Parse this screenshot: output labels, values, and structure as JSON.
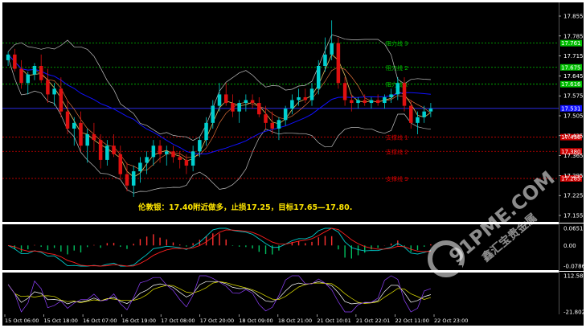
{
  "chart_data": [
    {
      "type": "candlestick",
      "ylim": [
        17.155,
        17.855
      ],
      "price_ticks": [
        "17.855",
        "17.785",
        "17.715",
        "17.645",
        "17.575",
        "17.505",
        "17.435",
        "17.365",
        "17.295",
        "17.225",
        "17.155"
      ],
      "current_price": "17.531",
      "current_price_value": 17.531,
      "x_labels": [
        "15 Oct 06:00",
        "15 Oct 18:00",
        "16 Oct 07:00",
        "16 Oct 19:00",
        "17 Oct 08:00",
        "17 Oct 20:00",
        "18 Oct 09:00",
        "18 Oct 21:00",
        "21 Oct 10:01",
        "21 Oct 22:01",
        "22 Oct 11:00",
        "22 Oct 23:00"
      ],
      "levels": [
        {
          "name": "阻力线 3",
          "value": 17.76,
          "tag": "17.761",
          "kind": "resistance"
        },
        {
          "name": "阻力线 2",
          "value": 17.675,
          "tag": "17.675",
          "kind": "resistance"
        },
        {
          "name": "阻力线 1",
          "value": 17.616,
          "tag": "17.616",
          "kind": "resistance"
        },
        {
          "name": "支撑线 1",
          "value": 17.43,
          "tag": "17.430",
          "kind": "support"
        },
        {
          "name": "支撑线 2",
          "value": 17.38,
          "tag": "17.380",
          "kind": "support"
        },
        {
          "name": "支撑线 3",
          "value": 17.285,
          "tag": "17.285",
          "kind": "support"
        }
      ],
      "candles_ohlc": [
        [
          17.7,
          17.73,
          17.68,
          17.72
        ],
        [
          17.72,
          17.74,
          17.66,
          17.67
        ],
        [
          17.67,
          17.7,
          17.6,
          17.62
        ],
        [
          17.62,
          17.66,
          17.58,
          17.65
        ],
        [
          17.65,
          17.69,
          17.63,
          17.68
        ],
        [
          17.68,
          17.72,
          17.62,
          17.63
        ],
        [
          17.63,
          17.67,
          17.55,
          17.58
        ],
        [
          17.58,
          17.62,
          17.54,
          17.6
        ],
        [
          17.6,
          17.64,
          17.5,
          17.52
        ],
        [
          17.52,
          17.56,
          17.44,
          17.46
        ],
        [
          17.46,
          17.5,
          17.4,
          17.48
        ],
        [
          17.48,
          17.52,
          17.38,
          17.4
        ],
        [
          17.4,
          17.46,
          17.34,
          17.44
        ],
        [
          17.44,
          17.48,
          17.38,
          17.42
        ],
        [
          17.42,
          17.44,
          17.32,
          17.35
        ],
        [
          17.35,
          17.42,
          17.33,
          17.4
        ],
        [
          17.4,
          17.44,
          17.36,
          17.37
        ],
        [
          17.37,
          17.4,
          17.28,
          17.3
        ],
        [
          17.3,
          17.34,
          17.24,
          17.26
        ],
        [
          17.26,
          17.33,
          17.22,
          17.31
        ],
        [
          17.31,
          17.36,
          17.27,
          17.34
        ],
        [
          17.34,
          17.38,
          17.3,
          17.36
        ],
        [
          17.36,
          17.42,
          17.33,
          17.4
        ],
        [
          17.4,
          17.42,
          17.34,
          17.37
        ],
        [
          17.37,
          17.4,
          17.33,
          17.38
        ],
        [
          17.38,
          17.4,
          17.34,
          17.36
        ],
        [
          17.36,
          17.38,
          17.32,
          17.35
        ],
        [
          17.35,
          17.37,
          17.3,
          17.33
        ],
        [
          17.33,
          17.4,
          17.31,
          17.38
        ],
        [
          17.38,
          17.43,
          17.36,
          17.42
        ],
        [
          17.42,
          17.5,
          17.4,
          17.48
        ],
        [
          17.48,
          17.56,
          17.46,
          17.54
        ],
        [
          17.54,
          17.62,
          17.52,
          17.58
        ],
        [
          17.58,
          17.62,
          17.54,
          17.55
        ],
        [
          17.55,
          17.58,
          17.5,
          17.52
        ],
        [
          17.52,
          17.56,
          17.48,
          17.55
        ],
        [
          17.55,
          17.58,
          17.52,
          17.56
        ],
        [
          17.56,
          17.58,
          17.53,
          17.55
        ],
        [
          17.55,
          17.57,
          17.5,
          17.51
        ],
        [
          17.51,
          17.54,
          17.46,
          17.48
        ],
        [
          17.48,
          17.52,
          17.44,
          17.46
        ],
        [
          17.46,
          17.5,
          17.42,
          17.49
        ],
        [
          17.49,
          17.54,
          17.47,
          17.53
        ],
        [
          17.53,
          17.58,
          17.51,
          17.56
        ],
        [
          17.56,
          17.6,
          17.54,
          17.57
        ],
        [
          17.57,
          17.6,
          17.55,
          17.56
        ],
        [
          17.56,
          17.62,
          17.54,
          17.6
        ],
        [
          17.6,
          17.7,
          17.58,
          17.68
        ],
        [
          17.68,
          17.78,
          17.66,
          17.72
        ],
        [
          17.72,
          17.84,
          17.7,
          17.76
        ],
        [
          17.76,
          17.78,
          17.6,
          17.62
        ],
        [
          17.62,
          17.64,
          17.54,
          17.56
        ],
        [
          17.56,
          17.58,
          17.52,
          17.55
        ],
        [
          17.55,
          17.57,
          17.53,
          17.56
        ],
        [
          17.56,
          17.58,
          17.54,
          17.55
        ],
        [
          17.55,
          17.57,
          17.53,
          17.56
        ],
        [
          17.56,
          17.58,
          17.54,
          17.55
        ],
        [
          17.55,
          17.58,
          17.53,
          17.57
        ],
        [
          17.57,
          17.6,
          17.55,
          17.58
        ],
        [
          17.58,
          17.64,
          17.56,
          17.62
        ],
        [
          17.62,
          17.64,
          17.52,
          17.54
        ],
        [
          17.54,
          17.56,
          17.46,
          17.48
        ],
        [
          17.48,
          17.52,
          17.44,
          17.5
        ],
        [
          17.5,
          17.54,
          17.48,
          17.52
        ],
        [
          17.52,
          17.55,
          17.5,
          17.53
        ]
      ]
    },
    {
      "type": "macd",
      "ylim": [
        -0.0786,
        0.0651
      ],
      "ticks": [
        "0.0651",
        "0.00",
        "-0.0786"
      ]
    },
    {
      "type": "oscillator",
      "ylim": [
        -21.8022,
        112.5898
      ],
      "ticks": [
        "112.5898",
        "-21.8022"
      ]
    }
  ],
  "annotation": "伦敦银：17.40附近做多，止损17.25，目标17.65—17.80.",
  "watermark": {
    "main": "91PME.COM",
    "sub": "鑫汇宝贵金属"
  },
  "colors": {
    "background": "#000000",
    "bull": "#00d0d0",
    "bear": "#e01010",
    "resistance": "#00c000",
    "support": "#d00000",
    "bollinger": "#c0c0c0",
    "ma_fast": "#e0c060",
    "ma_slow": "#1010ff",
    "annotation": "#ffe600"
  }
}
